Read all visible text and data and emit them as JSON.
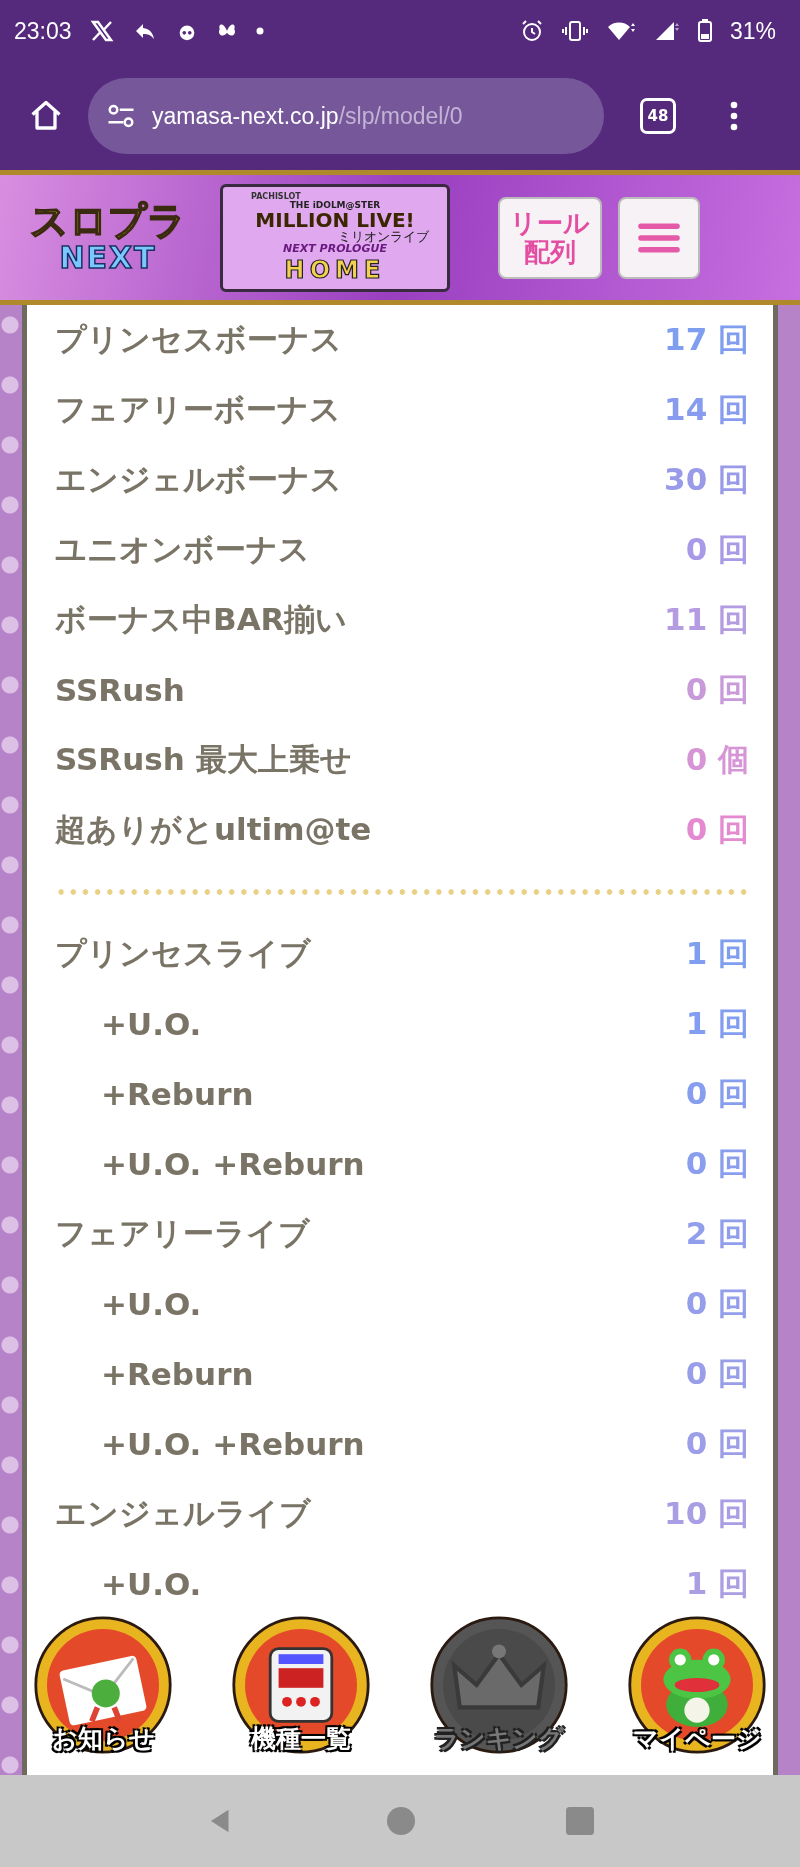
{
  "status_bar": {
    "time": "23:03",
    "battery": "31%"
  },
  "browser": {
    "url_host": "yamasa-next.co.jp",
    "url_path": "/slp/model/0",
    "tab_count": "48"
  },
  "header": {
    "logo_top": "スロプラ",
    "logo_bottom": "NEXT",
    "home": {
      "pachislot": "PACHISLOT",
      "brand": "THE iDOLM@STER",
      "title": "MILLION LIVE!",
      "title_kana": "ミリオンライブ",
      "subtitle": "NEXT PROLOGUE",
      "label": "HOME"
    },
    "reel_button": [
      "リール",
      "配列"
    ]
  },
  "sections": [
    {
      "rows": [
        {
          "label": "プリンセスボーナス",
          "value": "17 回",
          "color": "#7f9ef0"
        },
        {
          "label": "フェアリーボーナス",
          "value": "14 回",
          "color": "#879cee"
        },
        {
          "label": "エンジェルボーナス",
          "value": "30 回",
          "color": "#9a9be8"
        },
        {
          "label": "ユニオンボーナス",
          "value": "0 回",
          "color": "#a89ae6"
        },
        {
          "label": "ボーナス中BAR揃い",
          "value": "11 回",
          "color": "#b39ce0"
        },
        {
          "label": "SSRush",
          "value": "0 回",
          "color": "#c89ad9"
        },
        {
          "label": "SSRush 最大上乗せ",
          "value": "0 個",
          "color": "#d696d6"
        },
        {
          "label": "超ありがとultim@te",
          "value": "0 回",
          "color": "#e38ad0"
        }
      ]
    },
    {
      "rows": [
        {
          "label": "プリンセスライブ",
          "value": "1 回",
          "color": "#7f9ef0",
          "children": [
            {
              "label": "+U.O.",
              "value": "1 回",
              "color": "#839ef0"
            },
            {
              "label": "+Reburn",
              "value": "0 回",
              "color": "#879eee"
            },
            {
              "label": "+U.O. +Reburn",
              "value": "0 回",
              "color": "#8b9eee"
            }
          ]
        },
        {
          "label": "フェアリーライブ",
          "value": "2 回",
          "color": "#909eec",
          "children": [
            {
              "label": "+U.O.",
              "value": "0 回",
              "color": "#949eea"
            },
            {
              "label": "+Reburn",
              "value": "0 回",
              "color": "#989ee8"
            },
            {
              "label": "+U.O. +Reburn",
              "value": "0 回",
              "color": "#9c9ee8"
            }
          ]
        },
        {
          "label": "エンジェルライブ",
          "value": "10 回",
          "color": "#a89ee4",
          "children": [
            {
              "label": "+U.O.",
              "value": "1 回",
              "color": "#ac9ee2"
            }
          ]
        }
      ]
    }
  ],
  "bottom_nav": [
    {
      "label": "お知らせ",
      "kind": "envelope",
      "disabled": false
    },
    {
      "label": "機種一覧",
      "kind": "slot",
      "disabled": false
    },
    {
      "label": "ランキング",
      "kind": "crown",
      "disabled": true
    },
    {
      "label": "マイページ",
      "kind": "frog",
      "disabled": false
    }
  ]
}
